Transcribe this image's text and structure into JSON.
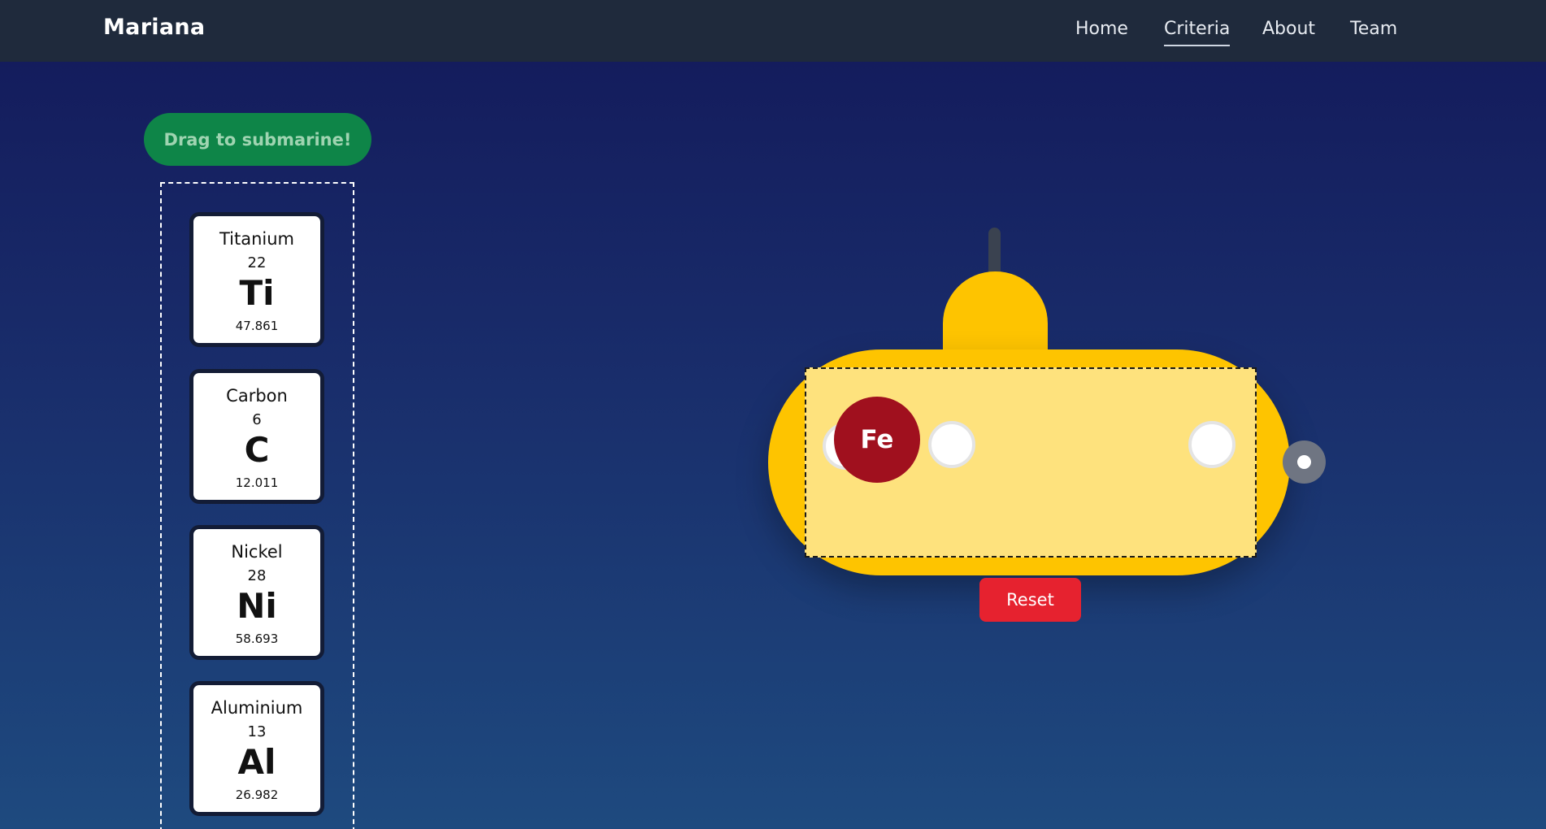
{
  "navbar": {
    "brand": "Mariana",
    "links": [
      {
        "label": "Home"
      },
      {
        "label": "Criteria",
        "active": true
      },
      {
        "label": "About"
      },
      {
        "label": "Team"
      }
    ]
  },
  "tray": {
    "instruction": "Drag to submarine!",
    "elements": [
      {
        "name": "Titanium",
        "number": "22",
        "symbol": "Ti",
        "mass": "47.861"
      },
      {
        "name": "Carbon",
        "number": "6",
        "symbol": "C",
        "mass": "12.011"
      },
      {
        "name": "Nickel",
        "number": "28",
        "symbol": "Ni",
        "mass": "58.693"
      },
      {
        "name": "Aluminium",
        "number": "13",
        "symbol": "Al",
        "mass": "26.982"
      }
    ]
  },
  "submarine": {
    "loaded_element": "Fe",
    "reset_label": "Reset"
  },
  "colors": {
    "navbar": "#1f2a3c",
    "background_top": "#13195a",
    "background_bottom": "#1e4a7f",
    "drag_label": "#0e8548",
    "submarine": "#fec400",
    "cargo_area": "#fee27d",
    "loaded_chip": "#a0101e",
    "reset_button": "#e6222f"
  }
}
